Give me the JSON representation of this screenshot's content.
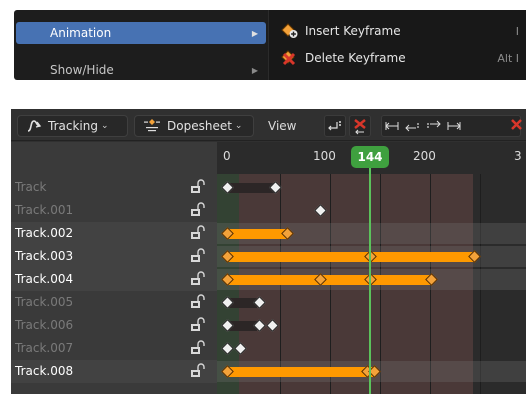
{
  "context_menu": {
    "items": [
      {
        "label": "Animation",
        "active": true
      },
      {
        "label": "Show/Hide",
        "active": false
      }
    ],
    "submenu": [
      {
        "label": "Insert Keyframe",
        "shortcut": "I",
        "icon": "keyframe-insert-icon"
      },
      {
        "label": "Delete Keyframe",
        "shortcut": "Alt I",
        "icon": "keyframe-delete-icon"
      }
    ]
  },
  "editor": {
    "mode": {
      "label": "Tracking",
      "icon": "tracking-icon"
    },
    "view_type": {
      "label": "Dopesheet",
      "icon": "dopesheet-icon"
    },
    "view_menu": "View",
    "toolbar_icons": [
      "jump-to-keyframe-icon",
      "clear-keyframe-icon",
      "prev-gap-icon",
      "jump-prev-icon",
      "jump-next-icon",
      "next-gap-icon",
      "delete-icon"
    ]
  },
  "timeline": {
    "ticks": [
      "0",
      "100",
      "200",
      "3"
    ],
    "current_frame": "144",
    "colors": {
      "selected_key": "#f3a23a",
      "playhead": "#3fa03f",
      "selected_segment": "#ff9900"
    }
  },
  "tracks": [
    {
      "name": "Track",
      "selected": false
    },
    {
      "name": "Track.001",
      "selected": false
    },
    {
      "name": "Track.002",
      "selected": true
    },
    {
      "name": "Track.003",
      "selected": true
    },
    {
      "name": "Track.004",
      "selected": true
    },
    {
      "name": "Track.005",
      "selected": false
    },
    {
      "name": "Track.006",
      "selected": false
    },
    {
      "name": "Track.007",
      "selected": false
    },
    {
      "name": "Track.008",
      "selected": true
    }
  ]
}
